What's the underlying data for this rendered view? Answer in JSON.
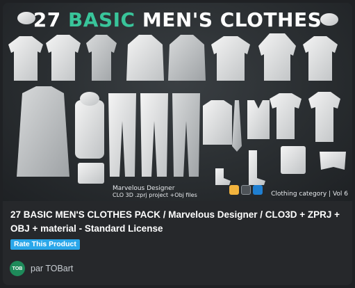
{
  "product": {
    "image_headline_number": "27",
    "image_headline_accent": "BASIC",
    "image_headline_rest": "MEN'S CLOTHES",
    "caption_line1": "Marvelous Designer",
    "caption_line2": "CLO 3D .zprj project +Obj files",
    "caption_right": "Clothing category | Vol 6",
    "title": "27 BASIC MEN'S CLOTHES PACK / Marvelous Designer / CLO3D + ZPRJ + OBJ + material - Standard License",
    "rate_label": "Rate This Product",
    "author_initials": "TOB",
    "author_text": "par TOBart"
  },
  "icons": {
    "software": [
      "marvelous-designer-icon",
      "clo3d-icon",
      "obj-cube-icon"
    ]
  },
  "colors": {
    "accent_green": "#39c49a",
    "badge_blue": "#2aa7ea",
    "avatar_green": "#1e8a5a"
  }
}
